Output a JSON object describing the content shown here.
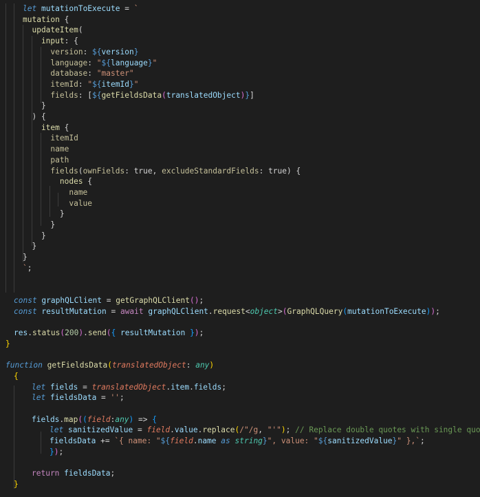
{
  "editor": {
    "language": "typescript",
    "lines": [
      [
        [
          "t-keyword",
          "let "
        ],
        [
          "t-var",
          "mutationToExecute"
        ],
        [
          "t-plain",
          " = "
        ],
        [
          "t-template",
          "`"
        ]
      ],
      [
        [
          "t-gql",
          "mutation "
        ],
        [
          "t-punct",
          "{"
        ]
      ],
      [
        [
          "t-gql",
          "  updateItem"
        ],
        [
          "t-punct",
          "("
        ]
      ],
      [
        [
          "t-gql",
          "    input"
        ],
        [
          "t-punct",
          ": {"
        ]
      ],
      [
        [
          "t-gqlfield",
          "      version"
        ],
        [
          "t-punct",
          ": "
        ],
        [
          "t-interp",
          "${"
        ],
        [
          "t-var",
          "version"
        ],
        [
          "t-interp",
          "}"
        ]
      ],
      [
        [
          "t-gqlfield",
          "      language"
        ],
        [
          "t-punct",
          ": "
        ],
        [
          "t-string",
          "\""
        ],
        [
          "t-interp",
          "${"
        ],
        [
          "t-var",
          "language"
        ],
        [
          "t-interp",
          "}"
        ],
        [
          "t-string",
          "\""
        ]
      ],
      [
        [
          "t-gqlfield",
          "      database"
        ],
        [
          "t-punct",
          ": "
        ],
        [
          "t-string",
          "\"master\""
        ]
      ],
      [
        [
          "t-gqlfield",
          "      itemId"
        ],
        [
          "t-punct",
          ": "
        ],
        [
          "t-string",
          "\""
        ],
        [
          "t-interp",
          "${"
        ],
        [
          "t-var",
          "itemId"
        ],
        [
          "t-interp",
          "}"
        ],
        [
          "t-string",
          "\""
        ]
      ],
      [
        [
          "t-gqlfield",
          "      fields"
        ],
        [
          "t-punct",
          ": ["
        ],
        [
          "t-interp",
          "${"
        ],
        [
          "t-func",
          "getFieldsData"
        ],
        [
          "t-bracket2",
          "("
        ],
        [
          "t-var",
          "translatedObject"
        ],
        [
          "t-bracket2",
          ")"
        ],
        [
          "t-interp",
          "}"
        ],
        [
          "t-punct",
          "]"
        ]
      ],
      [
        [
          "t-punct",
          "    }"
        ]
      ],
      [
        [
          "t-punct",
          "  ) {"
        ]
      ],
      [
        [
          "t-gql",
          "    item "
        ],
        [
          "t-punct",
          "{"
        ]
      ],
      [
        [
          "t-gqlfield",
          "      itemId"
        ]
      ],
      [
        [
          "t-gqlfield",
          "      name"
        ]
      ],
      [
        [
          "t-gqlfield",
          "      path"
        ]
      ],
      [
        [
          "t-gqlfield",
          "      fields"
        ],
        [
          "t-punct",
          "("
        ],
        [
          "t-gqlfield",
          "ownFields"
        ],
        [
          "t-punct",
          ": "
        ],
        [
          "t-bool",
          "true"
        ],
        [
          "t-punct",
          ", "
        ],
        [
          "t-gqlfield",
          "excludeStandardFields"
        ],
        [
          "t-punct",
          ": "
        ],
        [
          "t-bool",
          "true"
        ],
        [
          "t-punct",
          ") {"
        ]
      ],
      [
        [
          "t-gql",
          "        nodes "
        ],
        [
          "t-punct",
          "{"
        ]
      ],
      [
        [
          "t-gqlfield",
          "          name"
        ]
      ],
      [
        [
          "t-gqlfield",
          "          value"
        ]
      ],
      [
        [
          "t-punct",
          "        }"
        ]
      ],
      [
        [
          "t-punct",
          "      }"
        ]
      ],
      [
        [
          "t-punct",
          "    }"
        ]
      ],
      [
        [
          "t-punct",
          "  }"
        ]
      ],
      [
        [
          "t-punct",
          "}"
        ]
      ],
      [
        [
          "t-template",
          "`"
        ],
        [
          "t-punct",
          ";"
        ]
      ],
      [],
      [],
      [
        [
          "t-keyword",
          "const "
        ],
        [
          "t-var",
          "graphQLClient"
        ],
        [
          "t-plain",
          " = "
        ],
        [
          "t-func",
          "getGraphQLClient"
        ],
        [
          "t-bracket2",
          "("
        ],
        [
          "t-bracket2",
          ")"
        ],
        [
          "t-punct",
          ";"
        ]
      ],
      [
        [
          "t-keyword",
          "const "
        ],
        [
          "t-var",
          "resultMutation"
        ],
        [
          "t-plain",
          " = "
        ],
        [
          "t-ctrl",
          "await "
        ],
        [
          "t-var",
          "graphQLClient"
        ],
        [
          "t-punct",
          "."
        ],
        [
          "t-func",
          "request"
        ],
        [
          "t-punct",
          "<"
        ],
        [
          "t-type",
          "object"
        ],
        [
          "t-punct",
          ">"
        ],
        [
          "t-bracket2",
          "("
        ],
        [
          "t-func",
          "GraphQLQuery"
        ],
        [
          "t-bracket3",
          "("
        ],
        [
          "t-var",
          "mutationToExecute"
        ],
        [
          "t-bracket3",
          ")"
        ],
        [
          "t-bracket2",
          ")"
        ],
        [
          "t-punct",
          ";"
        ]
      ],
      [],
      [
        [
          "t-var",
          "res"
        ],
        [
          "t-punct",
          "."
        ],
        [
          "t-func",
          "status"
        ],
        [
          "t-bracket2",
          "("
        ],
        [
          "t-number",
          "200"
        ],
        [
          "t-bracket2",
          ")"
        ],
        [
          "t-punct",
          "."
        ],
        [
          "t-func",
          "send"
        ],
        [
          "t-bracket2",
          "("
        ],
        [
          "t-bracket3",
          "{ "
        ],
        [
          "t-var",
          "resultMutation"
        ],
        [
          "t-bracket3",
          " }"
        ],
        [
          "t-bracket2",
          ")"
        ],
        [
          "t-punct",
          ";"
        ]
      ],
      [
        [
          "t-bracket1",
          "}"
        ]
      ],
      [],
      [
        [
          "t-keyword",
          "function "
        ],
        [
          "t-func",
          "getFieldsData"
        ],
        [
          "t-bracket1",
          "("
        ],
        [
          "t-param",
          "translatedObject"
        ],
        [
          "t-punct",
          ": "
        ],
        [
          "t-type",
          "any"
        ],
        [
          "t-bracket1",
          ")"
        ]
      ],
      [
        [
          "t-bracket1",
          "{"
        ]
      ],
      [
        [
          "t-keyword",
          "let "
        ],
        [
          "t-var",
          "fields"
        ],
        [
          "t-plain",
          " = "
        ],
        [
          "t-param",
          "translatedObject"
        ],
        [
          "t-punct",
          "."
        ],
        [
          "t-var",
          "item"
        ],
        [
          "t-punct",
          "."
        ],
        [
          "t-var",
          "fields"
        ],
        [
          "t-punct",
          ";"
        ]
      ],
      [
        [
          "t-keyword",
          "let "
        ],
        [
          "t-var",
          "fieldsData"
        ],
        [
          "t-plain",
          " = "
        ],
        [
          "t-string",
          "''"
        ],
        [
          "t-punct",
          ";"
        ]
      ],
      [],
      [
        [
          "t-var",
          "fields"
        ],
        [
          "t-punct",
          "."
        ],
        [
          "t-func",
          "map"
        ],
        [
          "t-bracket2",
          "("
        ],
        [
          "t-bracket3",
          "("
        ],
        [
          "t-param",
          "field"
        ],
        [
          "t-punct",
          ":"
        ],
        [
          "t-type",
          "any"
        ],
        [
          "t-bracket3",
          ")"
        ],
        [
          "t-plain",
          " => "
        ],
        [
          "t-bracket3",
          "{"
        ]
      ],
      [
        [
          "t-keyword",
          "let "
        ],
        [
          "t-var",
          "sanitizedValue"
        ],
        [
          "t-plain",
          " = "
        ],
        [
          "t-param",
          "field"
        ],
        [
          "t-punct",
          "."
        ],
        [
          "t-var",
          "value"
        ],
        [
          "t-punct",
          "."
        ],
        [
          "t-func",
          "replace"
        ],
        [
          "t-bracket1",
          "("
        ],
        [
          "t-string",
          "/\"/g"
        ],
        [
          "t-punct",
          ", "
        ],
        [
          "t-string",
          "\"'\""
        ],
        [
          "t-bracket1",
          ")"
        ],
        [
          "t-punct",
          "; "
        ],
        [
          "t-comment",
          "// Replace double quotes with single quotes"
        ]
      ],
      [
        [
          "t-var",
          "fieldsData"
        ],
        [
          "t-plain",
          " += "
        ],
        [
          "t-template",
          "`{ name: \""
        ],
        [
          "t-interp",
          "${"
        ],
        [
          "t-param",
          "field"
        ],
        [
          "t-punct",
          "."
        ],
        [
          "t-var",
          "name"
        ],
        [
          "t-keyword",
          " as "
        ],
        [
          "t-type",
          "string"
        ],
        [
          "t-interp",
          "}"
        ],
        [
          "t-template",
          "\", value: \""
        ],
        [
          "t-interp",
          "${"
        ],
        [
          "t-var",
          "sanitizedValue"
        ],
        [
          "t-interp",
          "}"
        ],
        [
          "t-template",
          "\" },`"
        ],
        [
          "t-punct",
          ";"
        ]
      ],
      [
        [
          "t-bracket3",
          "}"
        ],
        [
          "t-bracket2",
          ")"
        ],
        [
          "t-punct",
          ";"
        ]
      ],
      [],
      [
        [
          "t-ctrl",
          "return "
        ],
        [
          "t-var",
          "fieldsData"
        ],
        [
          "t-punct",
          ";"
        ]
      ],
      [
        [
          "t-bracket1",
          "}"
        ]
      ]
    ]
  }
}
